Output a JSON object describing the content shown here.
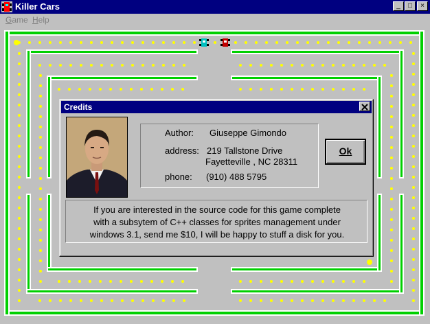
{
  "window": {
    "title": "Killer Cars",
    "menu": [
      "Game",
      "Help"
    ],
    "minimize_label": "_",
    "maximize_label": "□",
    "close_label": "×"
  },
  "colors": {
    "track_wall": "#00d000",
    "pellet": "#ffff00",
    "titlebar": "#000080",
    "board": "#c0c0c0"
  },
  "dialog": {
    "title": "Credits",
    "author_label": "Author:",
    "author_value": "Giuseppe Gimondo",
    "address_label": "address:",
    "address_line1": "219 Tallstone Drive",
    "address_line2": "Fayetteville , NC 28311",
    "phone_label": "phone:",
    "phone_value": "(910) 488 5795",
    "ok_label": "Ok",
    "message_lines": [
      "If you are interested in the source code for this game complete",
      "with a subsytem of C++ classes for sprites management under",
      "windows 3.1, send me $10, I will be happy to stuff a disk for you."
    ]
  }
}
